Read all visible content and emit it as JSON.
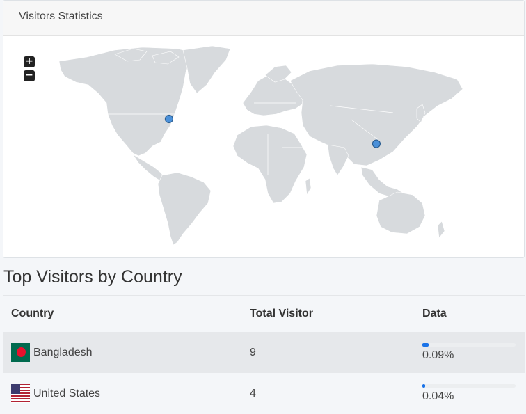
{
  "panel": {
    "title": "Visitors Statistics"
  },
  "map": {
    "zoom_in_label": "+",
    "zoom_out_label": "−",
    "markers": [
      {
        "country": "United States",
        "lat": 38.9,
        "lon": -77.0
      },
      {
        "country": "Bangladesh",
        "lat": 23.7,
        "lon": 90.4
      }
    ],
    "land_color": "#d7dadd",
    "marker_color": "#4a90d9"
  },
  "section": {
    "title": "Top Visitors by Country"
  },
  "table": {
    "headers": [
      "Country",
      "Total Visitor",
      "Data"
    ],
    "rows": [
      {
        "country": "Bangladesh",
        "flag": "bangladesh-flag",
        "visitors": "9",
        "percent": "0.09%",
        "share": 0.09
      },
      {
        "country": "United States",
        "flag": "us-flag",
        "visitors": "4",
        "percent": "0.04%",
        "share": 0.04
      }
    ],
    "bar_color": "#1a73e8"
  }
}
